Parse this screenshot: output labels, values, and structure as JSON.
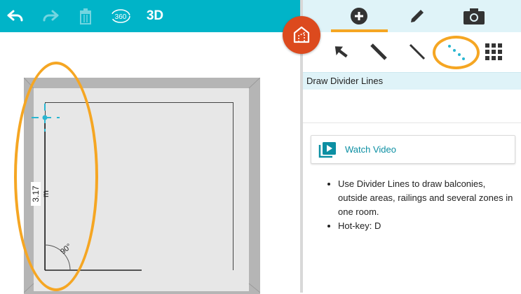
{
  "toolbar": {
    "undo_icon": "undo-icon",
    "redo_icon": "redo-icon",
    "trash_icon": "trash-icon",
    "view360_label": "360",
    "view3d_label": "3D"
  },
  "tabs": [
    {
      "name": "add",
      "icon": "plus-circle-icon",
      "selected": true
    },
    {
      "name": "edit",
      "icon": "pencil-icon",
      "selected": false
    },
    {
      "name": "camera",
      "icon": "camera-icon",
      "selected": false
    }
  ],
  "tools": [
    {
      "name": "select",
      "icon": "arrow-cursor-icon"
    },
    {
      "name": "draw-room",
      "icon": "thick-line-icon"
    },
    {
      "name": "draw-wall",
      "icon": "thin-line-icon"
    },
    {
      "name": "divider-lines",
      "icon": "dotted-line-icon",
      "selected": true
    },
    {
      "name": "grid",
      "icon": "grid-icon"
    }
  ],
  "tool_title": "Draw Divider Lines",
  "watch_video": {
    "label": "Watch Video",
    "icon": "video-playlist-icon"
  },
  "help_items": [
    "Use Divider Lines to draw balconies, outside areas, railings and several zones in one room.",
    "Hot-key: D"
  ],
  "canvas": {
    "dimension_label": "3.17 m",
    "angle_label": "90°"
  },
  "colors": {
    "accent": "#00b4c8",
    "highlight": "#f5a623",
    "logo": "#dc4a1e",
    "panel_tint": "#dff3f8"
  }
}
